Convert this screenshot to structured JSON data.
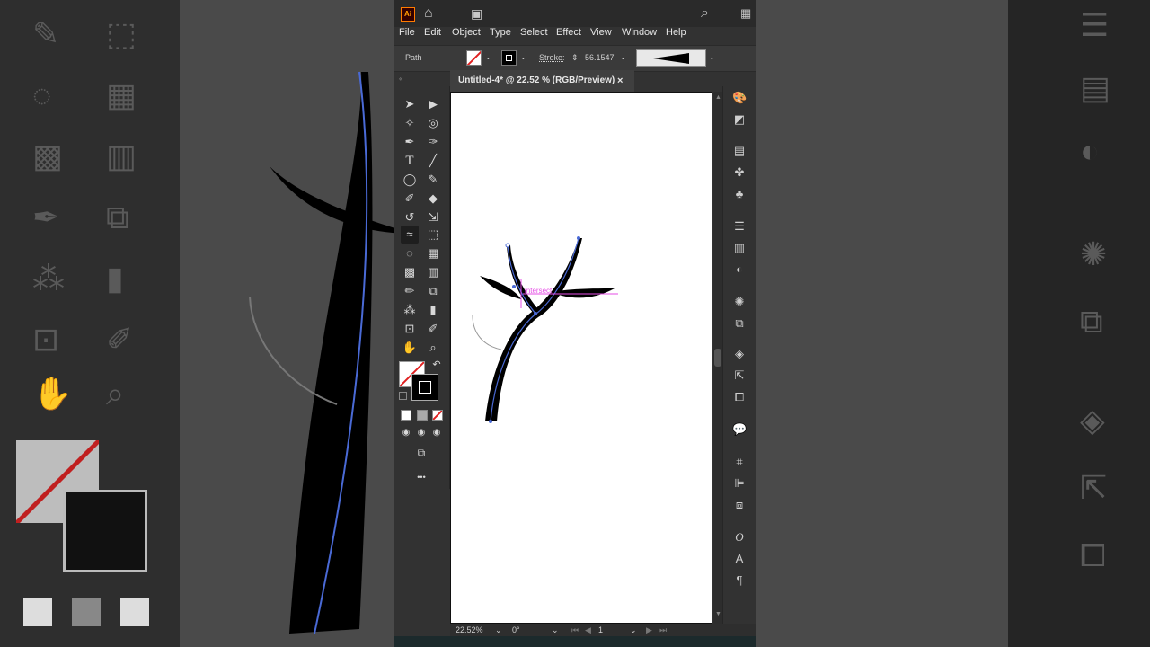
{
  "app": {
    "logo_text": "Ai",
    "menu": [
      "File",
      "Edit",
      "Object",
      "Type",
      "Select",
      "Effect",
      "View",
      "Window",
      "Help"
    ]
  },
  "control_bar": {
    "selection_label": "Path",
    "stroke_label": "Stroke:",
    "stroke_value": "56.1547"
  },
  "document": {
    "tab_title": "Untitled-4* @ 22.52 % (RGB/Preview)",
    "close_glyph": "×"
  },
  "canvas": {
    "smart_guide_label": "intersect"
  },
  "status_bar": {
    "zoom": "22.52%",
    "rotation": "0°",
    "artboard_number": "1"
  },
  "toolbar": {
    "more_tools_glyph": "•••"
  },
  "colors": {
    "accent_magenta": "#e64ee6",
    "path_blue": "#4a6ad6",
    "none_slash_red": "#e02020"
  }
}
